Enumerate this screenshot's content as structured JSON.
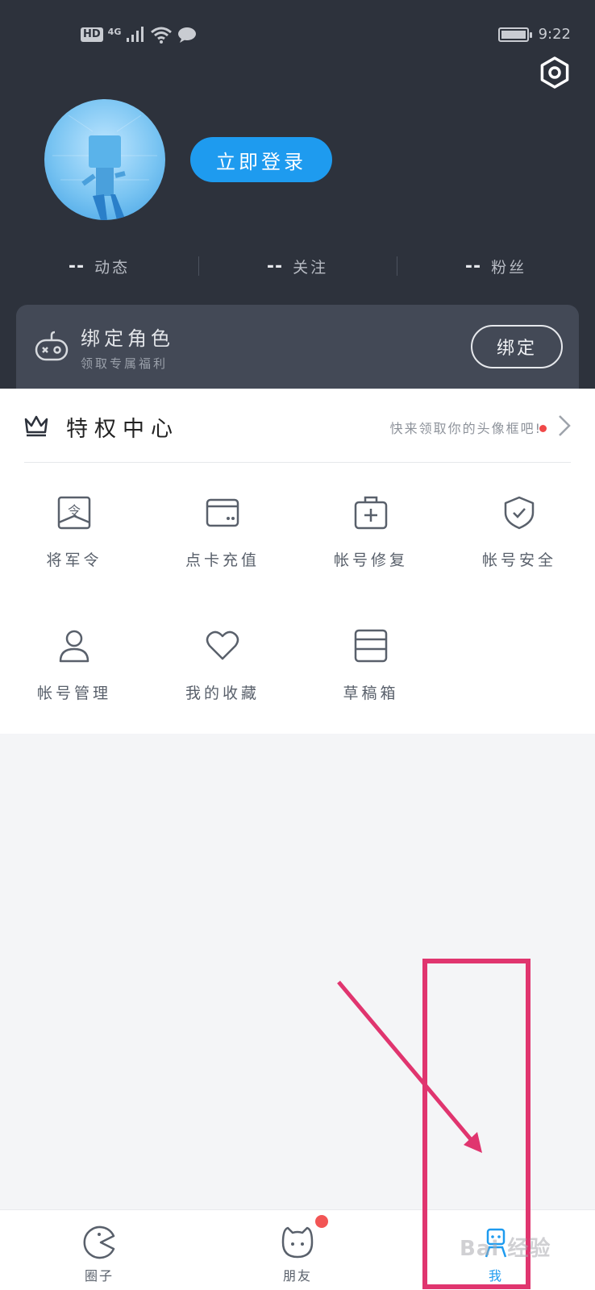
{
  "status_bar": {
    "hd": "HD",
    "network": "4G",
    "time": "9:22"
  },
  "profile": {
    "login_label": "立即登录",
    "stats": [
      {
        "value": "--",
        "label": "动态"
      },
      {
        "value": "--",
        "label": "关注"
      },
      {
        "value": "--",
        "label": "粉丝"
      }
    ]
  },
  "bind_card": {
    "title": "绑定角色",
    "subtitle": "领取专属福利",
    "button": "绑定"
  },
  "privilege": {
    "title": "特权中心",
    "hint": "快来领取你的头像框吧!"
  },
  "grid_items": [
    {
      "label": "将军令",
      "icon": "token-card-icon"
    },
    {
      "label": "点卡充值",
      "icon": "card-wallet-icon"
    },
    {
      "label": "帐号修复",
      "icon": "repair-kit-icon"
    },
    {
      "label": "帐号安全",
      "icon": "shield-check-icon"
    },
    {
      "label": "帐号管理",
      "icon": "person-icon"
    },
    {
      "label": "我的收藏",
      "icon": "heart-icon"
    },
    {
      "label": "草稿箱",
      "icon": "draft-box-icon"
    }
  ],
  "tabbar": [
    {
      "label": "圈子",
      "icon": "pacman-icon",
      "active": false
    },
    {
      "label": "朋友",
      "icon": "smiley-face-icon",
      "active": false
    },
    {
      "label": "我",
      "icon": "robot-profile-icon",
      "active": true
    }
  ],
  "colors": {
    "accent": "#1e9bef",
    "header_bg": "#2d323c",
    "annotation": "#e0356f"
  },
  "watermark": "Bai 经验"
}
